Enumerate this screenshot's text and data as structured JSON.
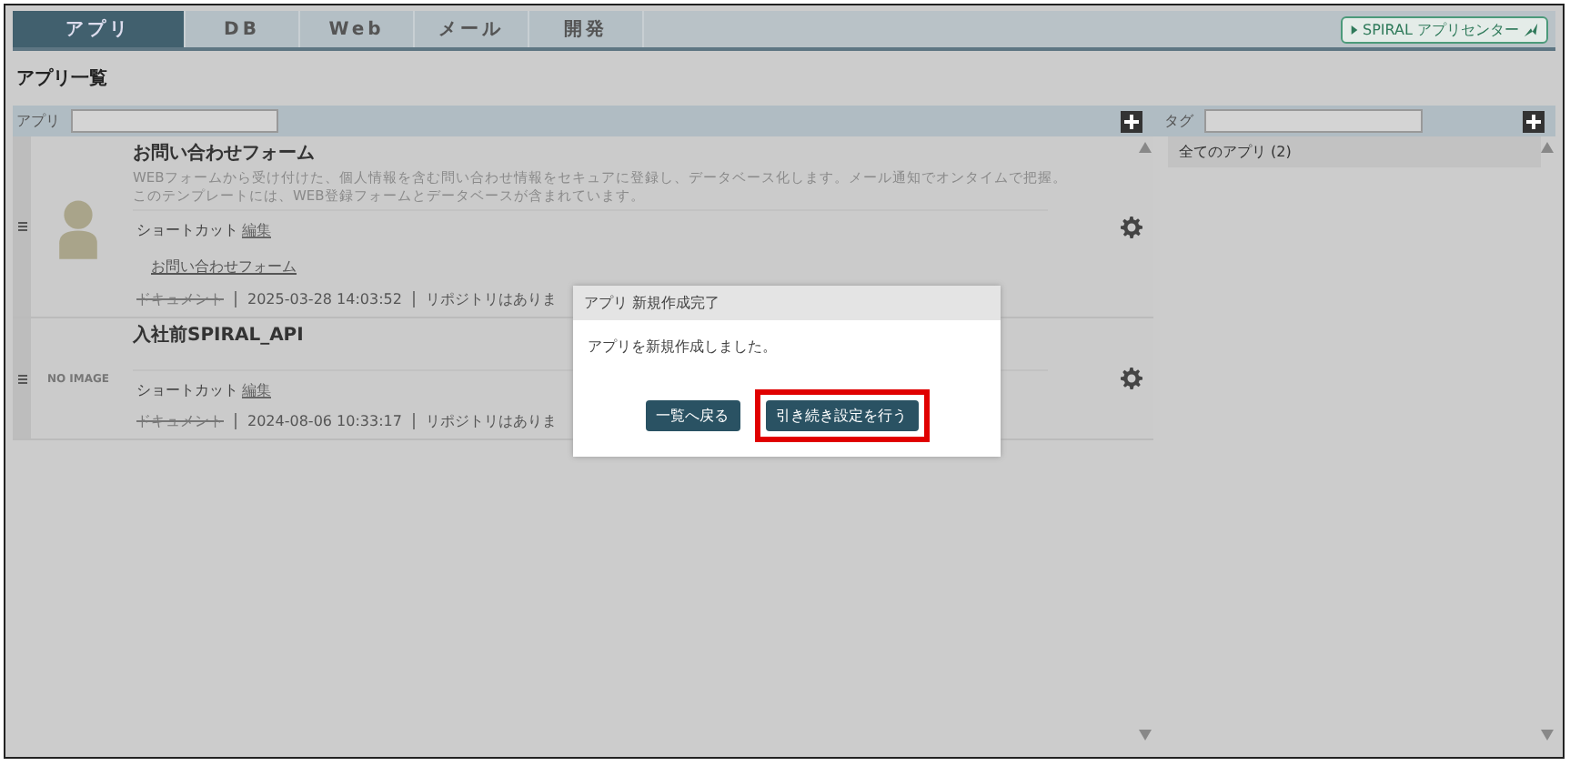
{
  "tabs": [
    {
      "label": "アプリ",
      "selected": true
    },
    {
      "label": "DB",
      "selected": false
    },
    {
      "label": "Web",
      "selected": false
    },
    {
      "label": "メール",
      "selected": false
    },
    {
      "label": "開発",
      "selected": false
    }
  ],
  "app_center_link": "SPIRAL アプリセンター",
  "page_title": "アプリ一覧",
  "app_filter": {
    "label": "アプリ"
  },
  "tag_filter": {
    "label": "タグ"
  },
  "apps": [
    {
      "name": "お問い合わせフォーム",
      "kind": "image",
      "description": [
        "WEBフォームから受け付けた、個人情報を含む問い合わせ情報をセキュアに登録し、データベース化します。メール通知でオンタイムで把握。",
        "このテンプレートには、WEB登録フォームとデータベースが含まれています。"
      ],
      "shortcut_label": "ショートカット",
      "shortcut_edit": "編集",
      "shortcuts": [
        "お問い合わせフォーム"
      ],
      "document": "ドキュメント",
      "updated": "2025-03-28 14:03:52",
      "repository": "リポジトリはありま"
    },
    {
      "name": "入社前SPIRAL_API",
      "kind": "no_image",
      "no_image_label": "NO IMAGE",
      "shortcut_label": "ショートカット",
      "shortcut_edit": "編集",
      "document": "ドキュメント",
      "updated": "2024-08-06 10:33:17",
      "repository": "リポジトリはありま"
    }
  ],
  "tags": [
    {
      "label": "全てのアプリ (2)",
      "selected": true
    }
  ],
  "dialog": {
    "title": "アプリ 新規作成完了",
    "message": "アプリを新規作成しました。",
    "buttons": [
      {
        "label": "一覧へ戻る",
        "highlighted": false
      },
      {
        "label": "引き続き設定を行う",
        "highlighted": true
      }
    ]
  }
}
